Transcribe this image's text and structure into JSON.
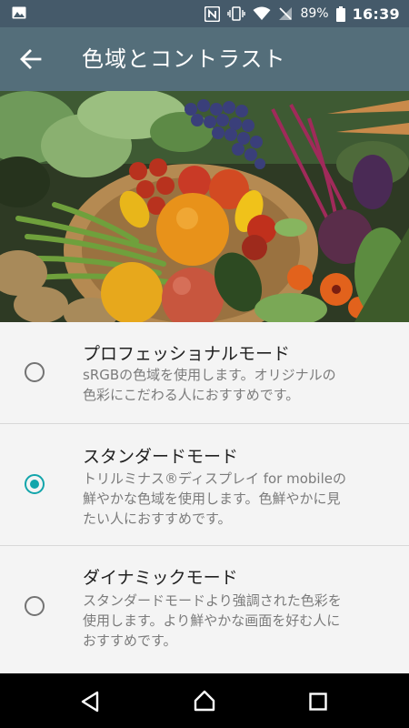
{
  "status_bar": {
    "battery_percent": "89%",
    "time": "16:39",
    "icons": [
      "image-notification-icon",
      "nfc-icon",
      "vibrate-icon",
      "wifi-icon",
      "no-signal-icon",
      "battery-icon"
    ]
  },
  "app_bar": {
    "title": "色域とコントラスト",
    "back_icon": "arrow-left-icon"
  },
  "header_image": "vegetables-photo",
  "options": [
    {
      "title": "プロフェッショナルモード",
      "desc1": "sRGBの色域を使用します。オリジナルの",
      "desc2": "色彩にこだわる人におすすめです。",
      "desc3": "",
      "selected": false
    },
    {
      "title": "スタンダードモード",
      "desc1": "トリルミナス®ディスプレイ for mobileの",
      "desc2": "鮮やかな色域を使用します。色鮮やかに見",
      "desc3": "たい人におすすめです。",
      "selected": true
    },
    {
      "title": "ダイナミックモード",
      "desc1": "スタンダードモードより強調された色彩を",
      "desc2": "使用します。より鮮やかな画面を好む人に",
      "desc3": "おすすめです。",
      "selected": false
    }
  ],
  "nav_bar": {
    "icons": [
      "back-triangle-icon",
      "home-icon",
      "recents-icon"
    ]
  },
  "colors": {
    "status_bar": "#455a6a",
    "app_bar": "#546e7a",
    "accent": "#12a5ab",
    "background": "#f4f4f4"
  }
}
